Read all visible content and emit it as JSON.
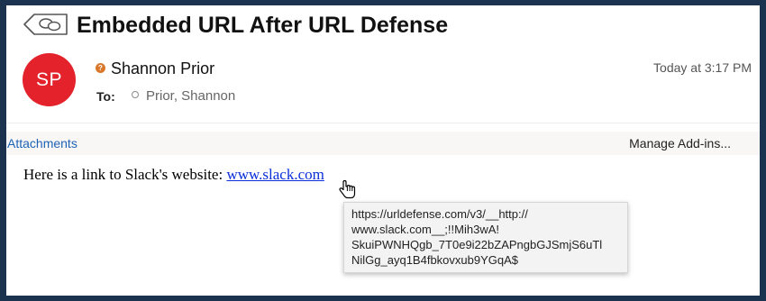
{
  "message": {
    "subject": "Embedded URL After URL Defense",
    "avatar_initials": "SP",
    "sender_name": "Shannon Prior",
    "to_label": "To:",
    "recipient": "Prior, Shannon",
    "timestamp": "Today at 3:17 PM"
  },
  "toolbar": {
    "attachments_label": "Attachments",
    "manage_addins_label": "Manage Add-ins..."
  },
  "body": {
    "text_before_link": "Here is a link to Slack's website: ",
    "link_text": "www.slack.com"
  },
  "tooltip": {
    "lines": [
      "https://urldefense.com/v3/__http://",
      "www.slack.com__;!!Mih3wA!",
      "SkuiPWNHQgb_7T0e9i22bZAPngbGJSmjS6uTl",
      "NilGg_ayq1B4fbkovxub9YGqA$"
    ]
  },
  "colors": {
    "avatar": "#e3222b",
    "link": "#0b2fd8",
    "attachments_link": "#1e63b5",
    "frame": "#1c3350",
    "status_dot": "#d9772a"
  },
  "icons": {
    "back": "back-arrow-bubbles-icon",
    "status": "status-question-icon",
    "cursor": "hand-pointer-cursor-icon"
  }
}
